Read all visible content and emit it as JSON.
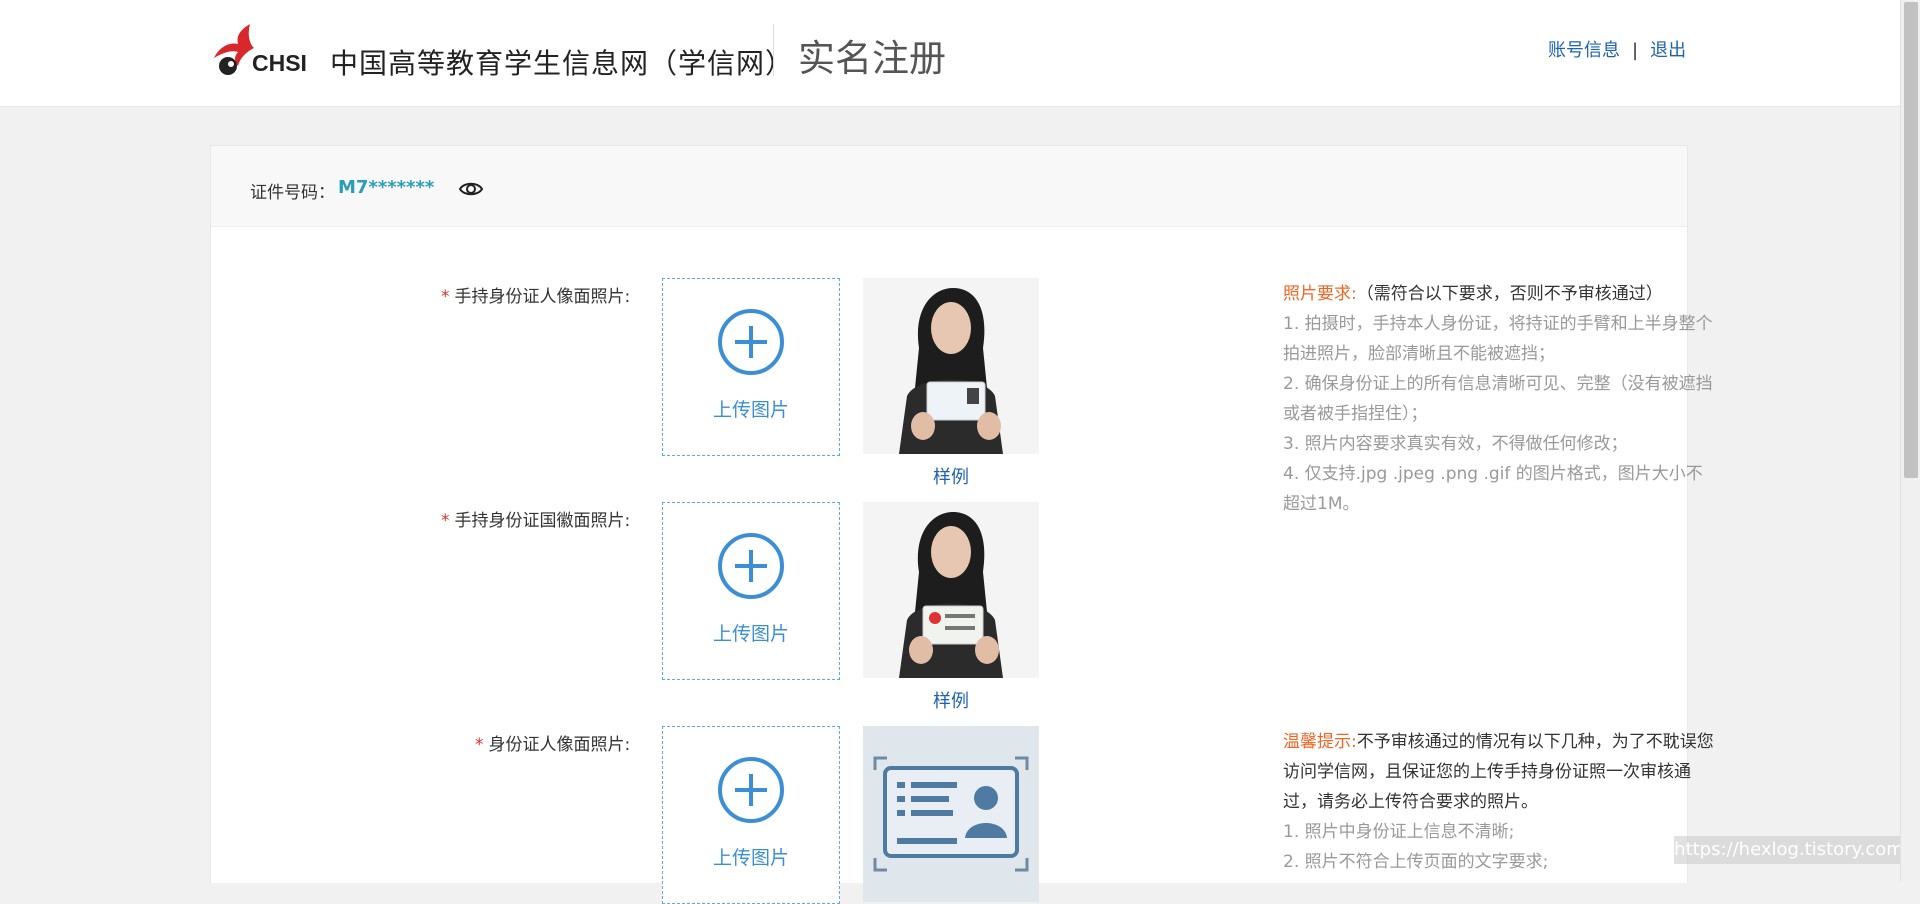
{
  "header": {
    "logo_text": "CHSI",
    "site_name": "中国高等教育学生信息网（学信网）",
    "page_title": "实名注册",
    "links": {
      "account": "账号信息",
      "separator": "|",
      "logout": "退出"
    }
  },
  "id_bar": {
    "label": "证件号码：",
    "value": "M7*******",
    "toggle_icon": "eye-icon"
  },
  "rows": [
    {
      "label": "手持身份证人像面照片:",
      "required": "*",
      "upload_label": "上传图片",
      "sample_label": "样例"
    },
    {
      "label": "手持身份证国徽面照片:",
      "required": "*",
      "upload_label": "上传图片",
      "sample_label": "样例"
    },
    {
      "label": "身份证人像面照片:",
      "required": "*",
      "upload_label": "上传图片"
    }
  ],
  "photo_requirements": {
    "title": "照片要求:",
    "subtitle": "（需符合以下要求，否则不予审核通过）",
    "items": [
      "1. 拍摄时，手持本人身份证，将持证的手臂和上半身整个拍进照片，脸部清晰且不能被遮挡；",
      "2. 确保身份证上的所有信息清晰可见、完整（没有被遮挡或者被手指捏住）；",
      "3. 照片内容要求真实有效，不得做任何修改；",
      "4. 仅支持.jpg .jpeg .png .gif 的图片格式，图片大小不超过1M。"
    ]
  },
  "tips": {
    "title": "温馨提示:",
    "intro": "不予审核通过的情况有以下几种，为了不耽误您访问学信网，且保证您的上传手持身份证照一次审核通过，请务必上传符合要求的照片。",
    "items": [
      "1. 照片中身份证上信息不清晰;",
      "2. 照片不符合上传页面的文字要求;"
    ]
  },
  "watermark": "https://hexlog.tistory.com",
  "colors": {
    "accent": "#3b8fd6",
    "link": "#1f62b5",
    "highlight": "#f26522",
    "required": "#e02d2d",
    "id_value": "#2a9db8"
  }
}
